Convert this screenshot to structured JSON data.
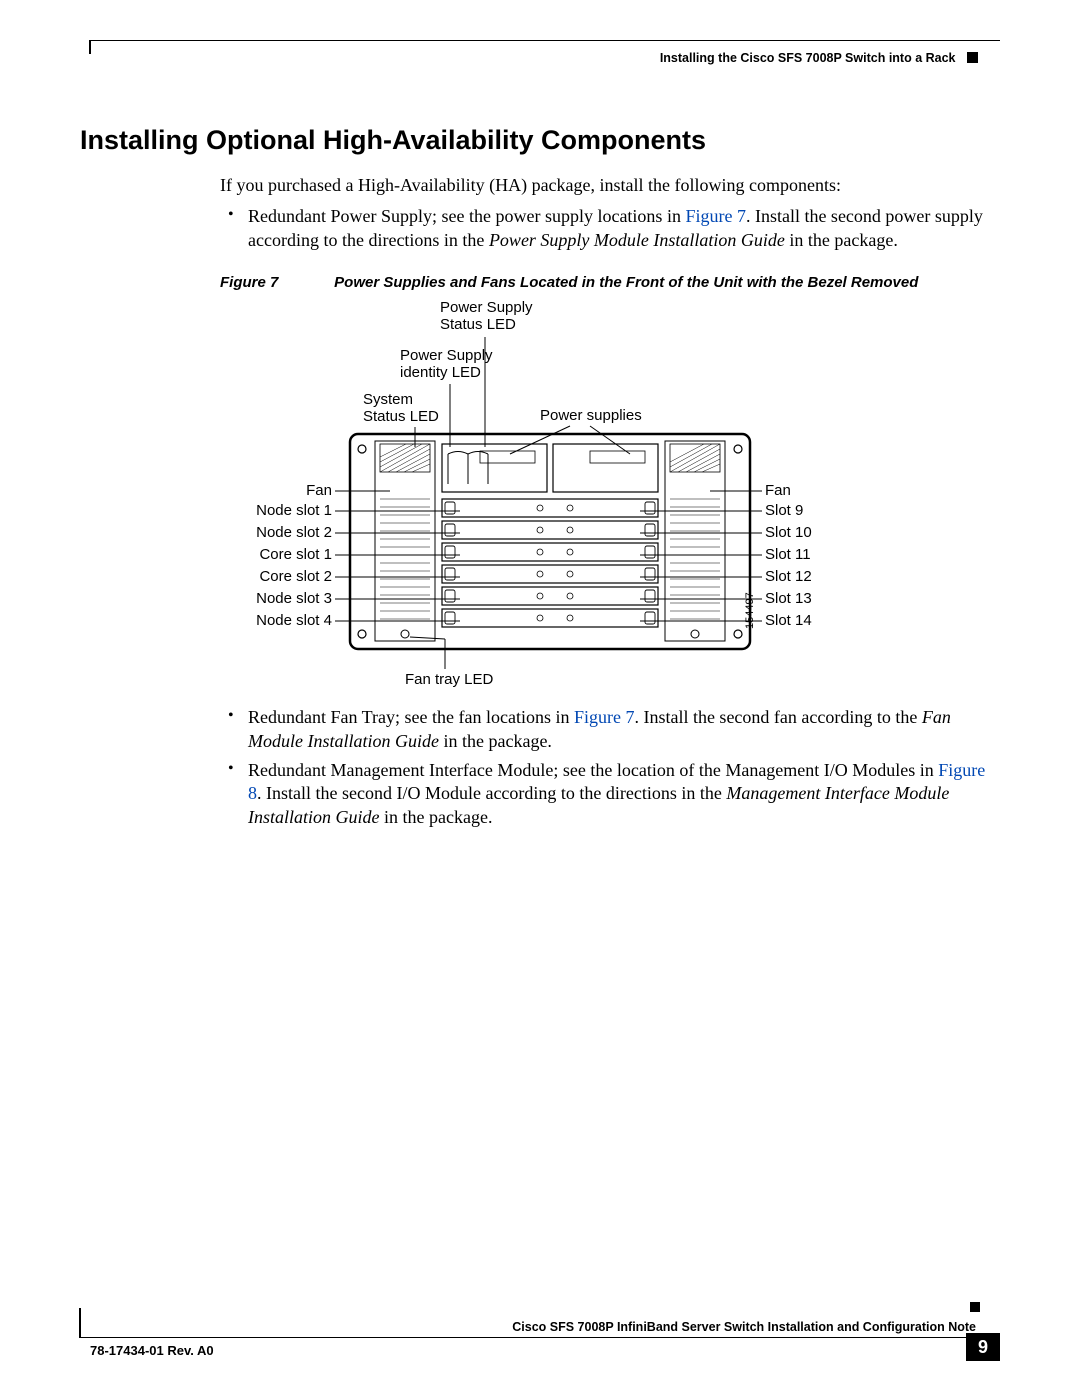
{
  "header": {
    "running_title": "Installing the Cisco SFS 7008P Switch into a Rack"
  },
  "section": {
    "title": "Installing Optional High-Availability Components",
    "intro": "If you purchased a High-Availability (HA) package, install the following components:",
    "bullet1_a": "Redundant Power Supply; see the power supply locations in ",
    "bullet1_ref": "Figure 7",
    "bullet1_b": ". Install the second power supply according to the directions in the ",
    "bullet1_i": "Power Supply Module Installation Guide",
    "bullet1_c": " in the package.",
    "figure_num": "Figure 7",
    "figure_title": "Power Supplies and Fans Located in the Front of the Unit with the Bezel Removed",
    "bullet2_a": "Redundant Fan Tray; see the fan locations in ",
    "bullet2_ref": "Figure 7",
    "bullet2_b": ". Install the second fan according to the ",
    "bullet2_i": "Fan Module Installation Guide",
    "bullet2_c": " in the package.",
    "bullet3_a": "Redundant Management Interface Module; see the location of the Management I/O Modules in ",
    "bullet3_ref": "Figure 8",
    "bullet3_b": ". Install the second I/O Module according to the directions in the ",
    "bullet3_i": "Management Interface Module Installation Guide",
    "bullet3_c": " in the package."
  },
  "diagram": {
    "labels": {
      "ps_status": "Power Supply\nStatus LED",
      "ps_identity": "Power Supply\nidentity LED",
      "sys_status": "System\nStatus LED",
      "power_supplies": "Power supplies",
      "fan_left": "Fan",
      "fan_right": "Fan",
      "node1": "Node slot 1",
      "node2": "Node slot 2",
      "core1": "Core slot 1",
      "core2": "Core slot 2",
      "node3": "Node slot 3",
      "node4": "Node slot 4",
      "slot9": "Slot 9",
      "slot10": "Slot 10",
      "slot11": "Slot 11",
      "slot12": "Slot 12",
      "slot13": "Slot 13",
      "slot14": "Slot 14",
      "fan_tray_led": "Fan tray LED",
      "partnum": "154497"
    }
  },
  "footer": {
    "doc_title": "Cisco SFS 7008P InfiniBand Server Switch Installation and Configuration Note",
    "doc_rev": "78-17434-01 Rev. A0",
    "page": "9"
  }
}
